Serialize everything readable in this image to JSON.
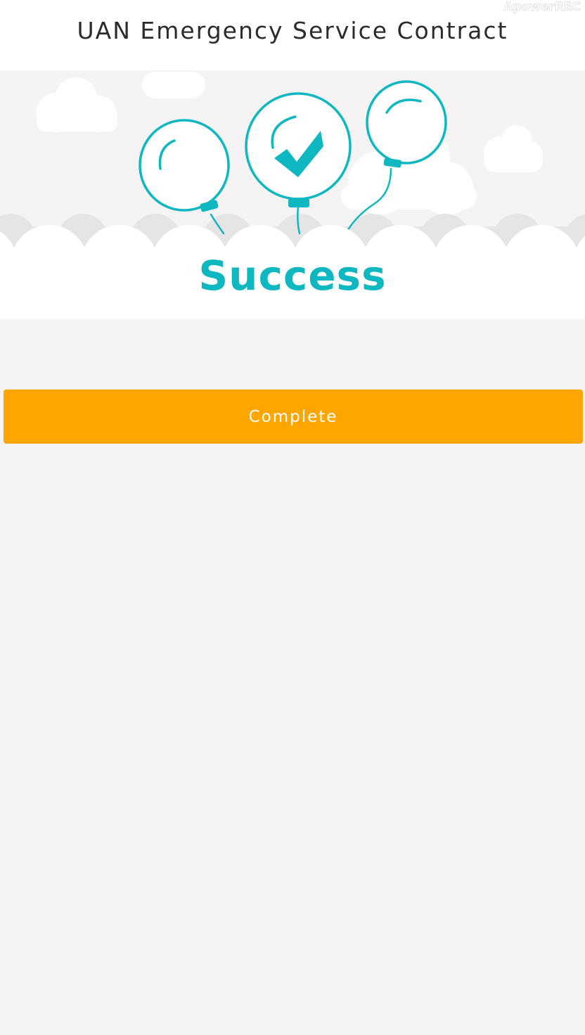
{
  "header": {
    "title": "UAN Emergency Service Contract",
    "watermark": "ApowerREC"
  },
  "hero": {
    "illustration_icon": "balloons-with-checkmark-icon",
    "status_title": "Success"
  },
  "actions": {
    "complete_label": "Complete"
  },
  "colors": {
    "accent_teal": "#0fb7c0",
    "button_orange": "#fea500",
    "page_background": "#f5f3f4",
    "header_background": "#ffffff"
  }
}
